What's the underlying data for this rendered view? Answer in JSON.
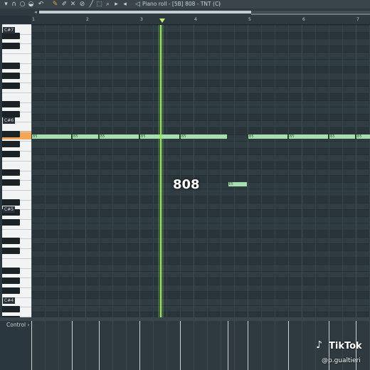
{
  "toolbar": {
    "window_title": "Piano roll - [5B] 808 - TNT (C)",
    "title_menu_arrow": "›",
    "icons": [
      "tools-icon",
      "magnet-icon",
      "loop-icon",
      "undo-icon",
      "pencil-icon",
      "paint-icon",
      "delete-icon",
      "mute-icon",
      "slice-icon",
      "select-icon",
      "zoom-icon",
      "play-icon",
      "speaker-icon"
    ]
  },
  "ruler": {
    "bar_numbers": [
      "1",
      "2",
      "3",
      "4",
      "5",
      "6",
      "7"
    ]
  },
  "keyboard": {
    "labels": [
      "C#7",
      "C#6",
      "C#5",
      "C#4"
    ],
    "active_key": "B5"
  },
  "notes": [
    {
      "label": "B5",
      "start_beat": 0.0,
      "length_beats": 0.75,
      "pitch": "B5"
    },
    {
      "label": "B5",
      "start_beat": 0.75,
      "length_beats": 0.5,
      "pitch": "B5"
    },
    {
      "label": "B5",
      "start_beat": 1.25,
      "length_beats": 0.75,
      "pitch": "B5"
    },
    {
      "label": "B5",
      "start_beat": 2.0,
      "length_beats": 0.75,
      "pitch": "B5"
    },
    {
      "label": "B5",
      "start_beat": 2.75,
      "length_beats": 0.875,
      "pitch": "B5"
    },
    {
      "label": "B5",
      "start_beat": 4.0,
      "length_beats": 0.75,
      "pitch": "B5"
    },
    {
      "label": "B5",
      "start_beat": 4.75,
      "length_beats": 0.75,
      "pitch": "B5"
    },
    {
      "label": "B5",
      "start_beat": 5.5,
      "length_beats": 0.5,
      "pitch": "B5"
    },
    {
      "label": "B5",
      "start_beat": 6.0,
      "length_beats": 0.3,
      "pitch": "B5"
    },
    {
      "label": "E5",
      "start_beat": 3.625,
      "length_beats": 0.375,
      "pitch": "E5"
    }
  ],
  "overlay_text": "808",
  "control": {
    "label": "Control",
    "arrow": "›"
  },
  "watermark": {
    "logo_glyph": "♪",
    "brand": "TikTok",
    "user": "@p.gualtieri"
  },
  "colors": {
    "playhead": "#9ae55a",
    "note": "#a8dfb0",
    "active_key": "#f1a65a"
  }
}
